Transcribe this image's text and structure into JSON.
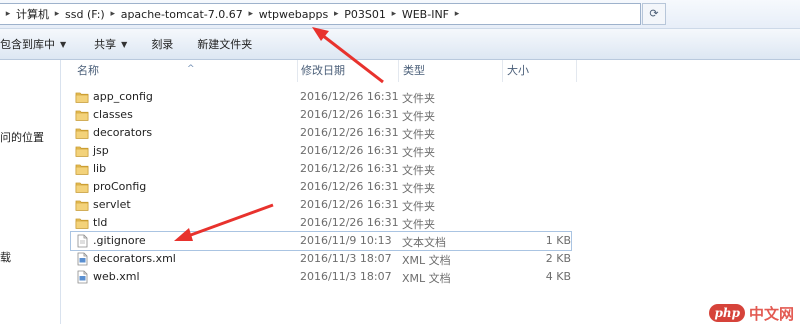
{
  "address": {
    "crumbs": [
      "计算机",
      "ssd (F:)",
      "apache-tomcat-7.0.67",
      "wtpwebapps",
      "P03S01",
      "WEB-INF"
    ],
    "refresh_icon": "refresh-icon"
  },
  "toolbar": {
    "include_label": "包含到库中",
    "share_label": "共享",
    "burn_label": "刻录",
    "new_folder_label": "新建文件夹"
  },
  "nav": {
    "recent_label": "问的位置",
    "partial_label": "载"
  },
  "columns": {
    "name": "名称",
    "modified": "修改日期",
    "type": "类型",
    "size": "大小"
  },
  "files": [
    {
      "name": "app_config",
      "date": "2016/12/26 16:31",
      "type": "文件夹",
      "size": "",
      "icon": "folder-icon"
    },
    {
      "name": "classes",
      "date": "2016/12/26 16:31",
      "type": "文件夹",
      "size": "",
      "icon": "folder-icon"
    },
    {
      "name": "decorators",
      "date": "2016/12/26 16:31",
      "type": "文件夹",
      "size": "",
      "icon": "folder-icon"
    },
    {
      "name": "jsp",
      "date": "2016/12/26 16:31",
      "type": "文件夹",
      "size": "",
      "icon": "folder-icon"
    },
    {
      "name": "lib",
      "date": "2016/12/26 16:31",
      "type": "文件夹",
      "size": "",
      "icon": "folder-icon"
    },
    {
      "name": "proConfig",
      "date": "2016/12/26 16:31",
      "type": "文件夹",
      "size": "",
      "icon": "folder-icon"
    },
    {
      "name": "servlet",
      "date": "2016/12/26 16:31",
      "type": "文件夹",
      "size": "",
      "icon": "folder-icon"
    },
    {
      "name": "tld",
      "date": "2016/12/26 16:31",
      "type": "文件夹",
      "size": "",
      "icon": "folder-icon"
    },
    {
      "name": ".gitignore",
      "date": "2016/11/9 10:13",
      "type": "文本文档",
      "size": "1 KB",
      "icon": "text-file-icon"
    },
    {
      "name": "decorators.xml",
      "date": "2016/11/3 18:07",
      "type": "XML 文档",
      "size": "2 KB",
      "icon": "xml-file-icon"
    },
    {
      "name": "web.xml",
      "date": "2016/11/3 18:07",
      "type": "XML 文档",
      "size": "4 KB",
      "icon": "xml-file-icon"
    }
  ],
  "watermark": {
    "logo": "php",
    "text": "中文网"
  },
  "colors": {
    "annotation_arrow": "#e8322d",
    "folder": "#e8c15a",
    "header_text": "#4c607a",
    "selection_border": "#aac4e2"
  }
}
